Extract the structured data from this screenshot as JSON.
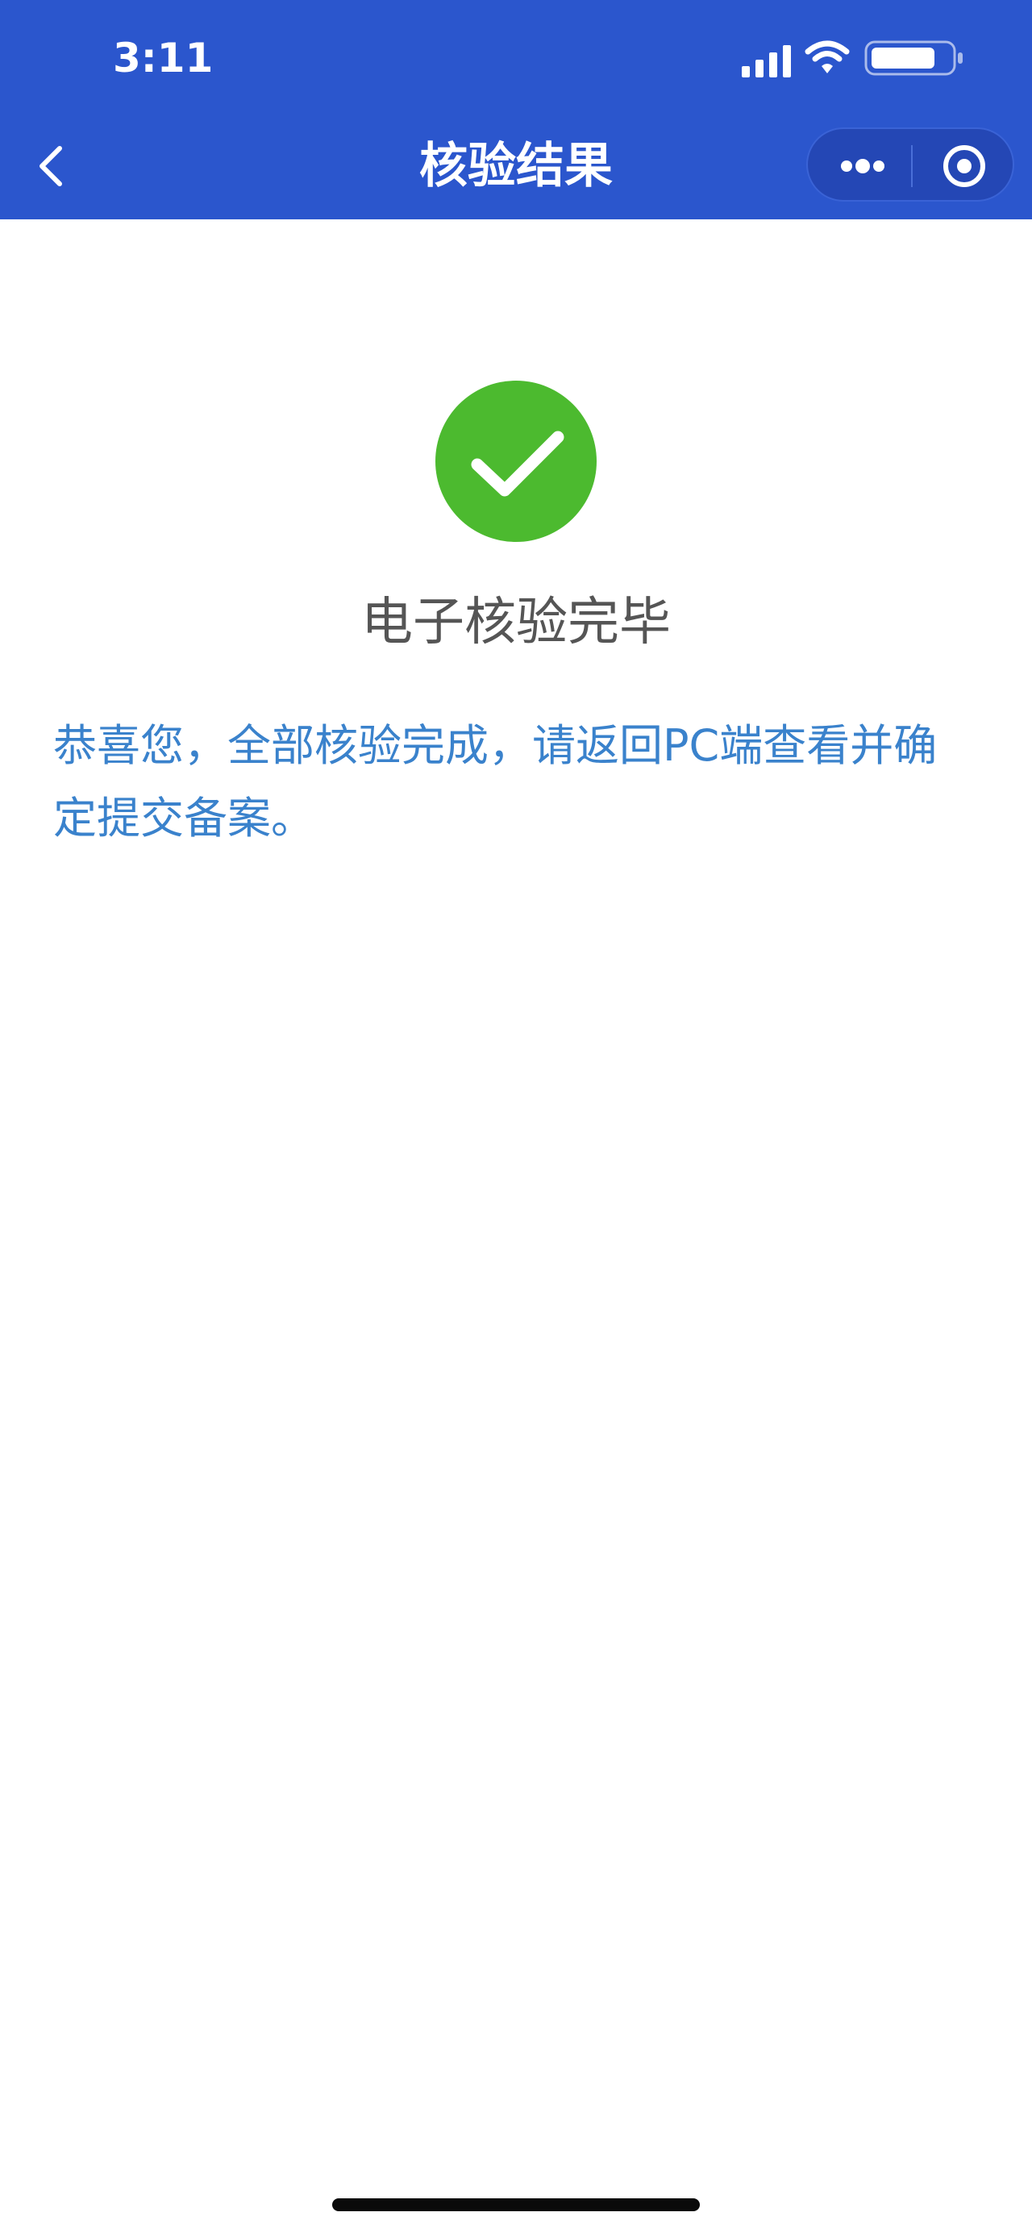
{
  "status_bar": {
    "time": "3:11"
  },
  "nav": {
    "title": "核验结果",
    "back_icon": "chevron-left-icon",
    "more_icon": "more-dots-icon",
    "close_icon": "circle-target-icon"
  },
  "result": {
    "icon": "check-circle-icon",
    "title": "电子核验完毕",
    "message": "恭喜您，全部核验完成，请返回PC端查看并确定提交备案。"
  },
  "colors": {
    "nav_bg": "#2b56cd",
    "success_green": "#4cba2f",
    "message_blue": "#3a82cc",
    "title_gray": "#555555"
  }
}
